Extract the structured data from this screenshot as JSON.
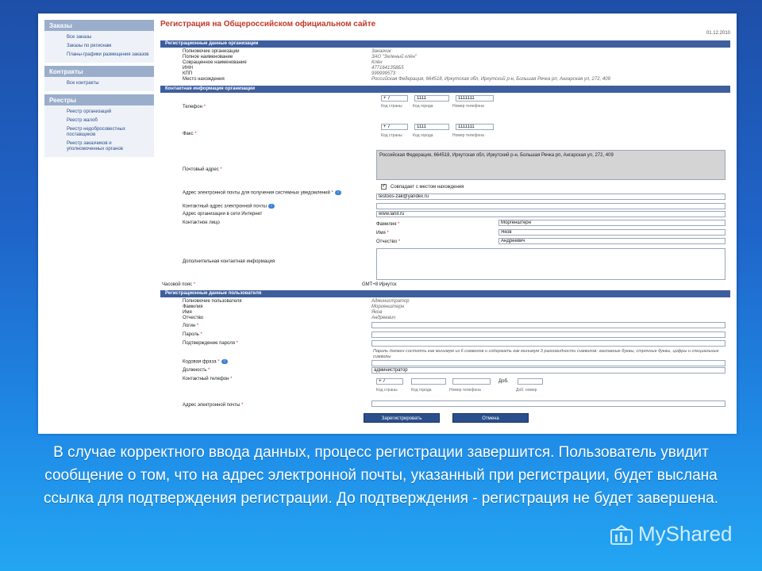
{
  "sidebar": {
    "sections": [
      {
        "title": "Заказы",
        "items": [
          "Все заказы",
          "Заказы по регионам",
          "Планы-графики размещения заказов"
        ]
      },
      {
        "title": "Контракты",
        "items": [
          "Все контракты"
        ]
      },
      {
        "title": "Реестры",
        "items": [
          "Реестр организаций",
          "Реестр жалоб",
          "Реестр недобросовестных поставщиков",
          "Реестр заказчиков и уполномоченных органов"
        ]
      }
    ]
  },
  "page": {
    "title": "Регистрация на Общероссийском официальном сайте",
    "date": "01.12.2010"
  },
  "org": {
    "section_title": "Регистрационные данные организации",
    "rows": [
      {
        "label": "Полномочие организации",
        "value": "Заказчик"
      },
      {
        "label": "Полное наименование",
        "value": "ЗАО \"Зеленый клён\""
      },
      {
        "label": "Сокращенное наименование",
        "value": "Клён"
      },
      {
        "label": "ИНН",
        "value": "4771641358Б5"
      },
      {
        "label": "КПП",
        "value": "999999573"
      },
      {
        "label": "Место нахождения",
        "value": "Российская Федерация, 664518, Иркутская обл, Иркутский р-н, Большая Речка рп, Ангарская ул, 272, 409"
      }
    ]
  },
  "contact": {
    "section_title": "Контактная информация организации",
    "phone_label": "Телефон",
    "phone": {
      "country": "+ 7",
      "city": "1111",
      "number": "1111111"
    },
    "fax_label": "Факс",
    "fax": {
      "country": "+ 7",
      "city": "1111",
      "number": "1111111"
    },
    "sub_country": "Код страны",
    "sub_city": "Код города",
    "sub_number": "Номер телефона",
    "postal_label": "Почтовый адрес",
    "postal_value": "Российская Федерация, 664518, Иркутская обл, Иркутский р-н, Большая Речка рп, Ангарская ул, 272, 409",
    "same_as_location": "Совпадает с местом нахождения",
    "email_notify_label": "Адрес электронной почты для получения системных уведомлений",
    "email_notify_value": "testoos-zak@yandex.ru",
    "contact_email_label": "Контактный адрес электронной почты",
    "website_label": "Адрес организации в сети Интернет",
    "website_value": "www.lanit.ru",
    "contact_person_label": "Контактное лицо",
    "surname_label": "Фамилия",
    "surname_value": "Моргенштерн",
    "name_label": "Имя",
    "name_value": "Яков",
    "patronymic_label": "Отчество",
    "patronymic_value": "Андреевич",
    "extra_label": "Дополнительная контактная информация",
    "tz_label": "Часовой пояс",
    "tz_value": "GMT+8 Иркутск"
  },
  "user": {
    "section_title": "Регистрационные данные пользователя",
    "rows": [
      {
        "label": "Полномочие пользователя",
        "value": "Администратор"
      },
      {
        "label": "Фамилия",
        "value": "Моргенштерн"
      },
      {
        "label": "Имя",
        "value": "Яков"
      },
      {
        "label": "Отчество",
        "value": "Андреевич"
      }
    ],
    "login_label": "Логин",
    "password_label": "Пароль",
    "confirm_label": "Подтверждение пароля",
    "password_hint": "Пароль должен состоять как минимум из 6 символов и содержать как минимум 3 разновидности символов: заглавные буквы, строчные буквы, цифры и специальные символы",
    "code_phrase_label": "Кодовая фраза",
    "position_label": "Должность",
    "position_value": "администратор",
    "phone_label": "Контактный телефон",
    "phone_country": "+ 7",
    "ext_label": "Доб.",
    "sub_ext": "Доб. номер",
    "email_label": "Адрес электронной почты"
  },
  "buttons": {
    "register": "Зарегистрировать",
    "cancel": "Отмена"
  },
  "caption": "В случае корректного ввода данных, процесс регистрации завершится. Пользователь увидит сообщение о том, что на адрес электронной почты, указанный при регистрации, будет выслана ссылка для подтверждения регистрации. До подтверждения - регистрация не будет завершена.",
  "watermark": "MyShared"
}
